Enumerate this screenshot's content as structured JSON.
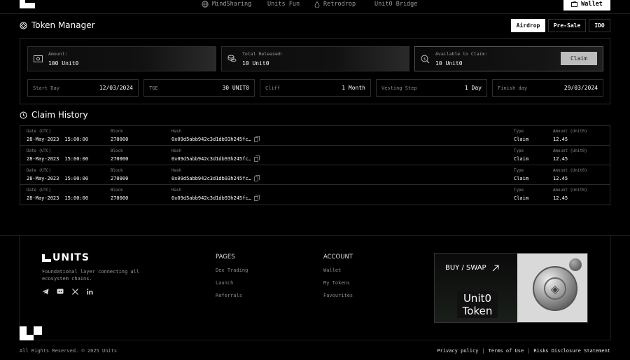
{
  "nav": {
    "items": [
      {
        "label": "MindSharing",
        "icon": "globe-icon"
      },
      {
        "label": "Units Fun",
        "icon": ""
      },
      {
        "label": "Retrodrop",
        "icon": "drop-icon"
      },
      {
        "label": "Unit0 Bridge",
        "icon": ""
      }
    ],
    "wallet_label": "Wallet"
  },
  "token_manager": {
    "title": "Token Manager",
    "tabs": [
      "Airdrop",
      "Pre-Sale",
      "IDO"
    ],
    "active_tab": "Airdrop",
    "amount_label": "Amount:",
    "amount_value": "100 Unit0",
    "released_label": "Total Released:",
    "released_value": "10 Unit0",
    "available_label": "Available to Claim:",
    "available_value": "10 Unit0",
    "claim_label": "Claim",
    "info": [
      {
        "label": "Start Day",
        "value": "12/03/2024"
      },
      {
        "label": "TGE",
        "value": "30 UNIT0"
      },
      {
        "label": "Cliff",
        "value": "1 Month"
      },
      {
        "label": "Vesting Step",
        "value": "1 Day"
      },
      {
        "label": "Finish day",
        "value": "29/03/2024"
      }
    ]
  },
  "claim_history": {
    "title": "Claim History",
    "columns": {
      "date": "Date (UTC)",
      "block": "Block",
      "hash": "Hash",
      "type": "Type",
      "amount": "Amount (Unit0)"
    },
    "rows": [
      {
        "date": "28-May-2023",
        "time": "15:00:00",
        "block": "270000",
        "hash": "0x09d5abb942c3d1db93h245fc…",
        "type": "Claim",
        "amount": "12.45"
      },
      {
        "date": "28-May-2023",
        "time": "15:00:00",
        "block": "270000",
        "hash": "0x09d5abb942c3d1db93h245fc…",
        "type": "Claim",
        "amount": "12.45"
      },
      {
        "date": "28-May-2023",
        "time": "15:00:00",
        "block": "270000",
        "hash": "0x09d5abb942c3d1db93h245fc…",
        "type": "Claim",
        "amount": "12.45"
      },
      {
        "date": "28-May-2023",
        "time": "15:00:00",
        "block": "270000",
        "hash": "0x09d5abb942c3d1db93h245fc…",
        "type": "Claim",
        "amount": "12.45"
      }
    ]
  },
  "footer": {
    "brand": "UNITS",
    "tagline": "Foundational layer connecting all ecosystem chains.",
    "pages_title": "PAGES",
    "pages": [
      "Dex Trading",
      "Launch",
      "Referrals"
    ],
    "account_title": "ACCOUNT",
    "account": [
      "Wallet",
      "My Tokens",
      "Favourites"
    ],
    "promo_buy": "BUY / SWAP",
    "promo_token_line1": "Unit0",
    "promo_token_line2": "Token",
    "copyright": "All Rights Reserved. © 2025 Units",
    "legal": [
      "Privacy policy",
      "Terms of Use",
      "Risks Disclosure Statement"
    ],
    "socials": [
      "telegram-icon",
      "discord-icon",
      "x-icon",
      "linkedin-icon"
    ]
  },
  "colors": {
    "background": "#000000",
    "accent": "#ffffff",
    "muted": "#9a9a9a"
  }
}
